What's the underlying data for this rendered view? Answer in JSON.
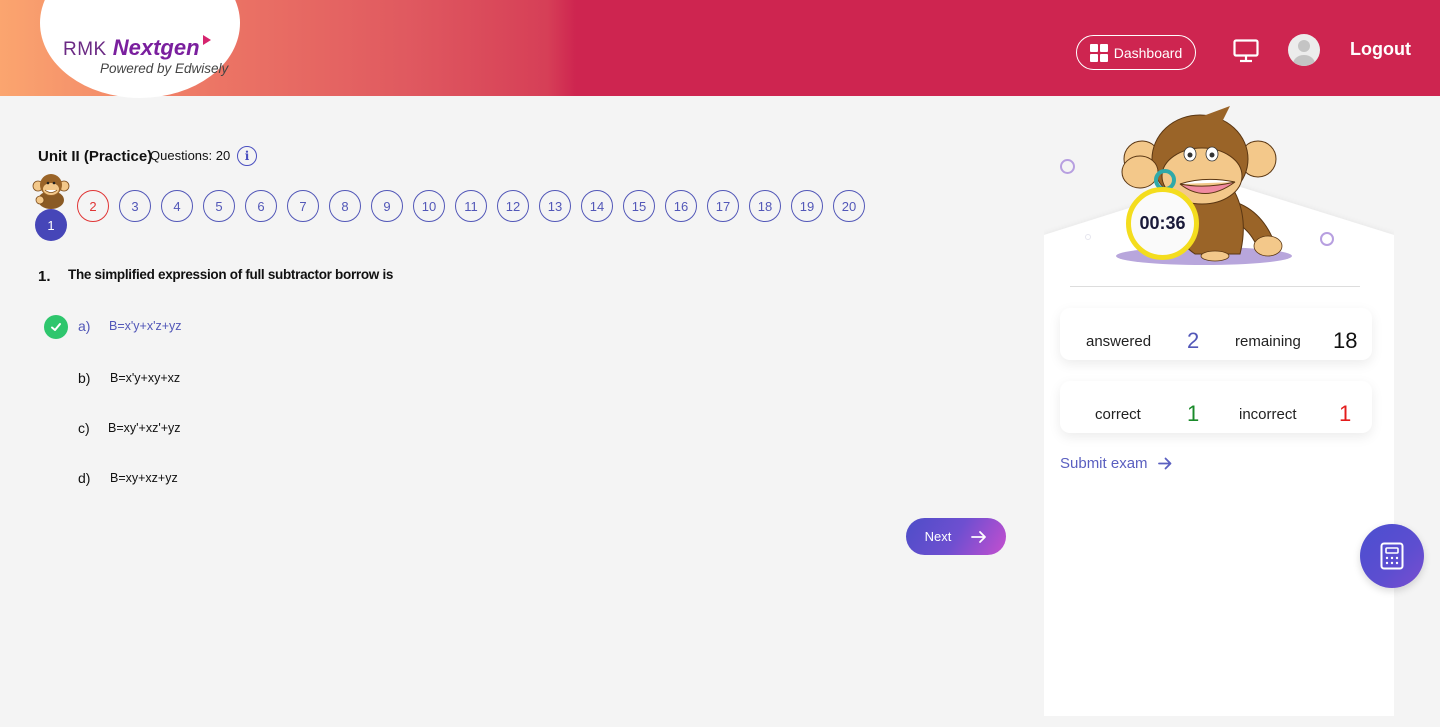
{
  "header": {
    "logo_brand": "RMK",
    "logo_product": "Nextgen",
    "logo_tagline": "Powered by Edwisely",
    "dashboard_label": "Dashboard",
    "logout_label": "Logout"
  },
  "exam": {
    "title": "Unit II (Practice)",
    "question_count_label": "Questions: 20",
    "info_glyph": "i",
    "current_question": 1,
    "questions": [
      {
        "number": "1",
        "status": "current"
      },
      {
        "number": "2",
        "status": "incorrect"
      },
      {
        "number": "3",
        "status": "unanswered"
      },
      {
        "number": "4",
        "status": "unanswered"
      },
      {
        "number": "5",
        "status": "unanswered"
      },
      {
        "number": "6",
        "status": "unanswered"
      },
      {
        "number": "7",
        "status": "unanswered"
      },
      {
        "number": "8",
        "status": "unanswered"
      },
      {
        "number": "9",
        "status": "unanswered"
      },
      {
        "number": "10",
        "status": "unanswered"
      },
      {
        "number": "11",
        "status": "unanswered"
      },
      {
        "number": "12",
        "status": "unanswered"
      },
      {
        "number": "13",
        "status": "unanswered"
      },
      {
        "number": "14",
        "status": "unanswered"
      },
      {
        "number": "15",
        "status": "unanswered"
      },
      {
        "number": "16",
        "status": "unanswered"
      },
      {
        "number": "17",
        "status": "unanswered"
      },
      {
        "number": "18",
        "status": "unanswered"
      },
      {
        "number": "19",
        "status": "unanswered"
      },
      {
        "number": "20",
        "status": "unanswered"
      }
    ]
  },
  "question": {
    "number_label": "1.",
    "text": "The simplified expression of full subtractor borrow is",
    "options": [
      {
        "letter": "a)",
        "text": "B=x'y+x'z+yz",
        "selected": true
      },
      {
        "letter": "b)",
        "text": "B=x'y+xy+xz",
        "selected": false
      },
      {
        "letter": "c)",
        "text": "B=xy'+xz'+yz",
        "selected": false
      },
      {
        "letter": "d)",
        "text": "B=xy+xz+yz",
        "selected": false
      }
    ],
    "next_label": "Next"
  },
  "sidebar": {
    "timer": "00:36",
    "answered_label": "answered",
    "answered_value": "2",
    "remaining_label": "remaining",
    "remaining_value": "18",
    "correct_label": "correct",
    "correct_value": "1",
    "incorrect_label": "incorrect",
    "incorrect_value": "1",
    "submit_label": "Submit exam"
  },
  "colors": {
    "header_start": "#fba56f",
    "header_end": "#ce2550",
    "accent": "#5257b8",
    "correct": "#1a8a2a",
    "incorrect": "#e31c1c",
    "check_green": "#2ec66d",
    "timer_ring": "#f4dd1e"
  }
}
